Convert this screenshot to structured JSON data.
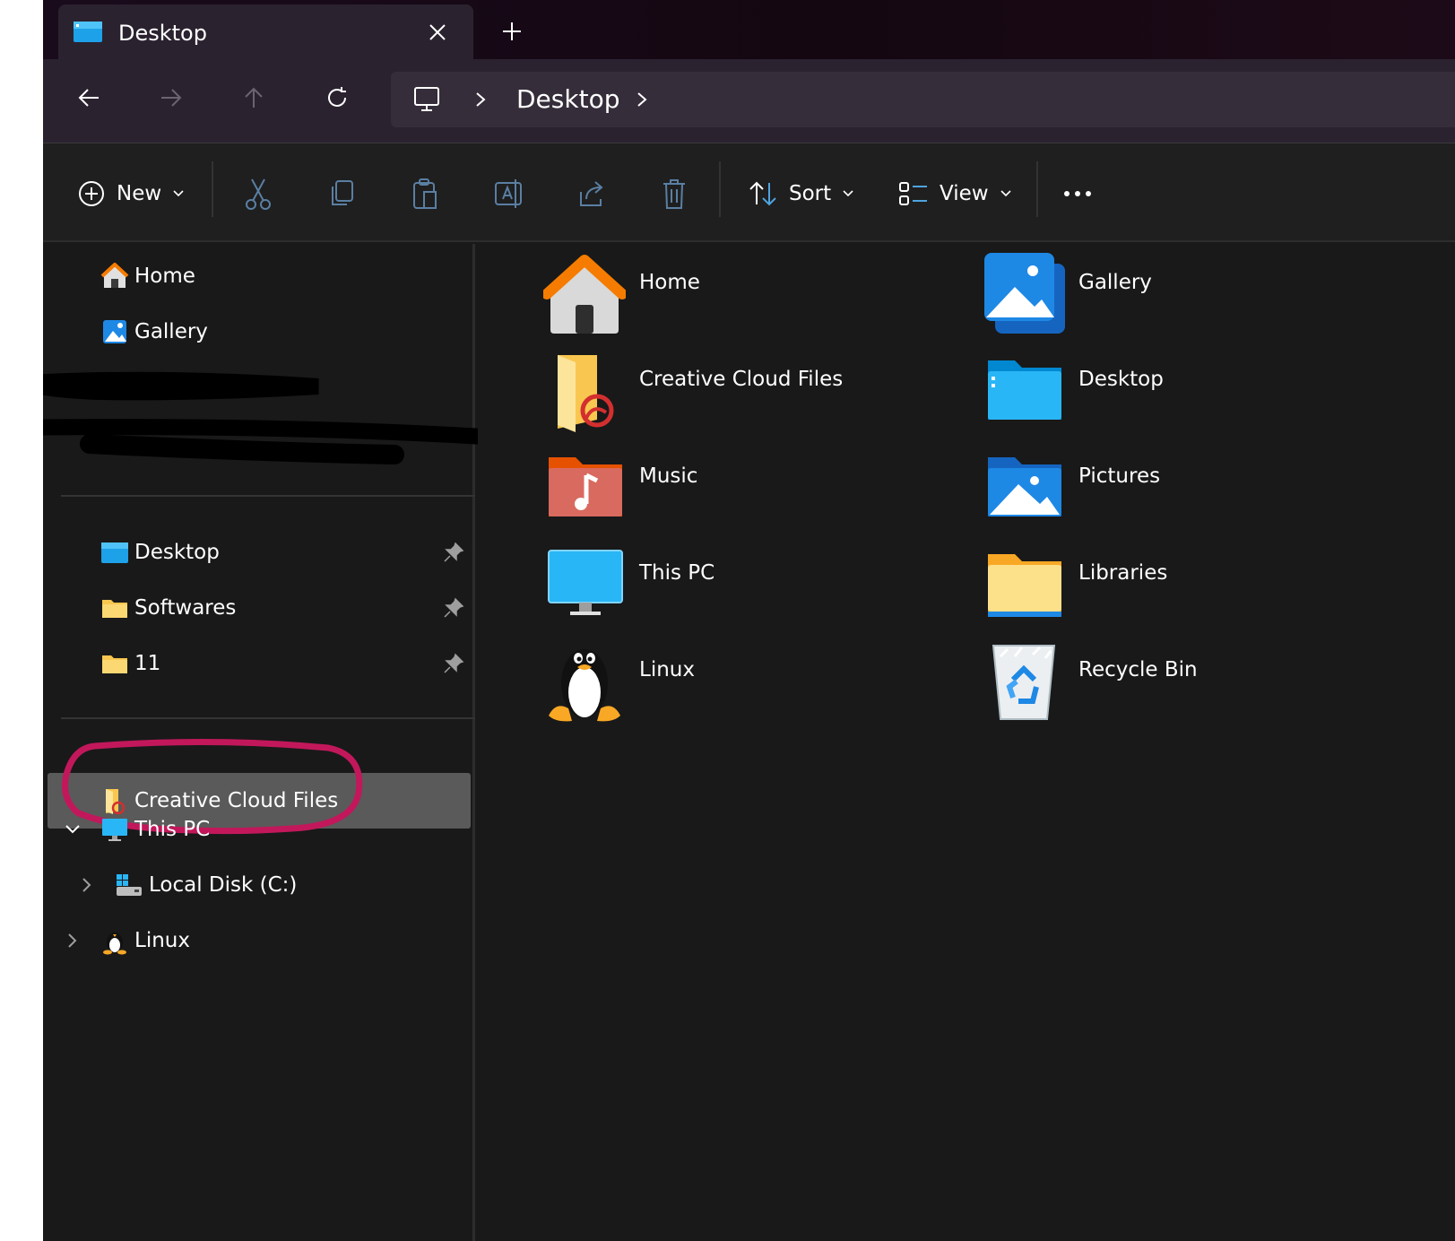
{
  "tab": {
    "title": "Desktop"
  },
  "address": {
    "crumbs": [
      "Desktop"
    ]
  },
  "toolbar": {
    "new_label": "New",
    "sort_label": "Sort",
    "view_label": "View",
    "icons": [
      "plus-circle-icon",
      "cut-icon",
      "copy-icon",
      "paste-icon",
      "rename-icon",
      "share-icon",
      "delete-icon",
      "sort-icon",
      "view-icon",
      "more-icon"
    ]
  },
  "sidebar": {
    "top": [
      {
        "label": "Home",
        "icon": "home-icon"
      },
      {
        "label": "Gallery",
        "icon": "gallery-icon"
      }
    ],
    "pinned": [
      {
        "label": "Desktop",
        "icon": "desktop-folder-icon"
      },
      {
        "label": "Softwares",
        "icon": "folder-icon"
      },
      {
        "label": "11",
        "icon": "folder-icon"
      }
    ],
    "tree": [
      {
        "label": "Creative Cloud Files",
        "icon": "creative-cloud-folder-icon",
        "selected": true
      },
      {
        "label": "This PC",
        "icon": "monitor-icon",
        "expanded": true
      },
      {
        "label": "Local Disk (C:)",
        "icon": "drive-icon"
      },
      {
        "label": "Linux",
        "icon": "linux-penguin-icon"
      }
    ]
  },
  "content": {
    "items": [
      {
        "label": "Home",
        "icon": "home-icon"
      },
      {
        "label": "Gallery",
        "icon": "gallery-icon"
      },
      {
        "label": "Creative Cloud Files",
        "icon": "creative-cloud-folder-icon"
      },
      {
        "label": "Desktop",
        "icon": "desktop-folder-icon"
      },
      {
        "label": "Music",
        "icon": "music-folder-icon"
      },
      {
        "label": "Pictures",
        "icon": "pictures-folder-icon"
      },
      {
        "label": "This PC",
        "icon": "monitor-icon"
      },
      {
        "label": "Libraries",
        "icon": "libraries-folder-icon"
      },
      {
        "label": "Linux",
        "icon": "linux-penguin-icon"
      },
      {
        "label": "Recycle Bin",
        "icon": "recycle-bin-icon"
      }
    ]
  },
  "colors": {
    "window_bg": "#191919",
    "selection": "#5a5a5a",
    "annotation_ring": "#c2185b",
    "accent_blue": "#1e88e5",
    "folder_yellow": "#f9c74f"
  }
}
